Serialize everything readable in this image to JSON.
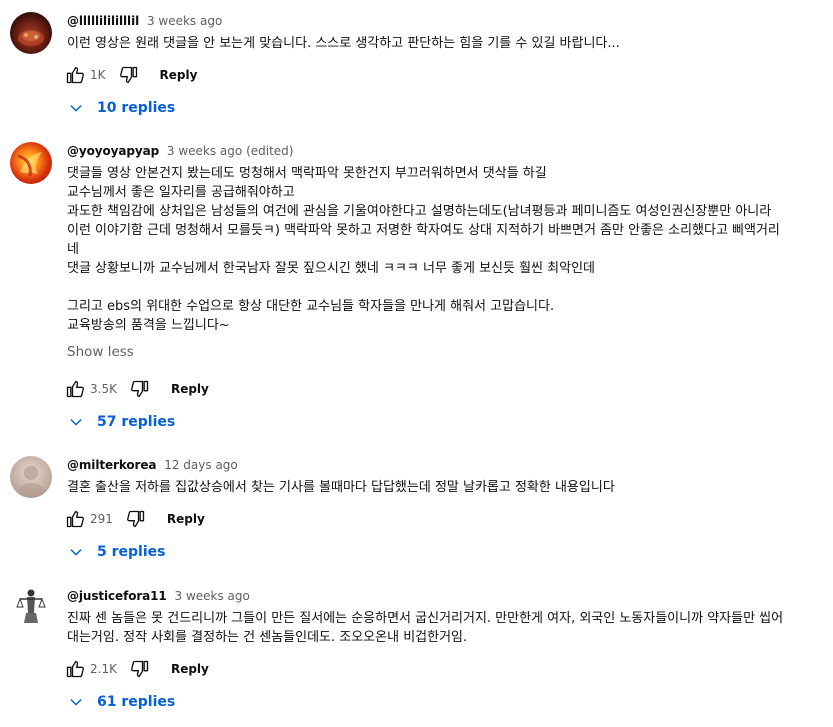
{
  "comments": [
    {
      "author": "@lllllilililllil",
      "time": "3 weeks ago",
      "lines": [
        "이런 영상은 원래 댓글을 안 보는게 맞습니다. 스스로 생각하고 판단하는 힘을 기를 수 있길 바랍니다..."
      ],
      "likes": "1K",
      "reply_label": "Reply",
      "replies_label": "10 replies"
    },
    {
      "author": "@yoyoyapyap",
      "time": "3 weeks ago (edited)",
      "lines": [
        "댓글들 영상 안본건지 봤는데도 멍청해서 맥락파악 못한건지 부끄러워하면서 댓삭들 하길",
        "교수님께서 좋은 일자리를 공급해줘야하고",
        "과도한 책임감에 상처입은 남성들의 여건에 관심을 기울여야한다고 설명하는데도(남녀평등과 페미니즘도 여성인권신장뿐만 아니라",
        "이런 이야기함 근데 멍청해서 모를듯ㅋ) 맥락파악 못하고 저명한 학자여도 상대 지적하기 바쁘면거 좀만 안좋은 소리했다고 삐액거리",
        "네",
        "댓글 상황보니까 교수님께서 한국남자 잘못 짚으시긴 했네 ㅋㅋㅋ 너무 좋게 보신듯 훨씬 최악인데",
        "",
        "그리고 ebs의 위대한 수업으로 항상 대단한 교수님들 학자들을 만나게 해줘서 고맙습니다.",
        "교육방송의 품격을 느낍니다~"
      ],
      "show_less": "Show less",
      "likes": "3.5K",
      "reply_label": "Reply",
      "replies_label": "57 replies"
    },
    {
      "author": "@milterkorea",
      "time": "12 days ago",
      "lines": [
        "결혼 출산을 저하를 집값상승에서 찾는 기사를 볼때마다 답답했는데 정말 날카롭고 정확한 내용입니다"
      ],
      "likes": "291",
      "reply_label": "Reply",
      "replies_label": "5 replies"
    },
    {
      "author": "@justicefora11",
      "time": "3 weeks ago",
      "lines": [
        "진짜 센 놈들은 못 건드리니까 그들이 만든 질서에는 순응하면서 굽신거리거지. 만만한게 여자, 외국인 노동자들이니까 약자들만 씹어",
        "대는거임. 정작 사회를 결정하는 건 센놈들인데도. 조오오온내 비겁한거임."
      ],
      "likes": "2.1K",
      "reply_label": "Reply",
      "replies_label": "61 replies"
    }
  ],
  "icons": {
    "like": "thumbs-up-icon",
    "dislike": "thumbs-down-icon",
    "expand": "chevron-down-icon"
  },
  "colors": {
    "link_blue": "#065fd4",
    "secondary_text": "#606060",
    "primary_text": "#0f0f0f"
  }
}
